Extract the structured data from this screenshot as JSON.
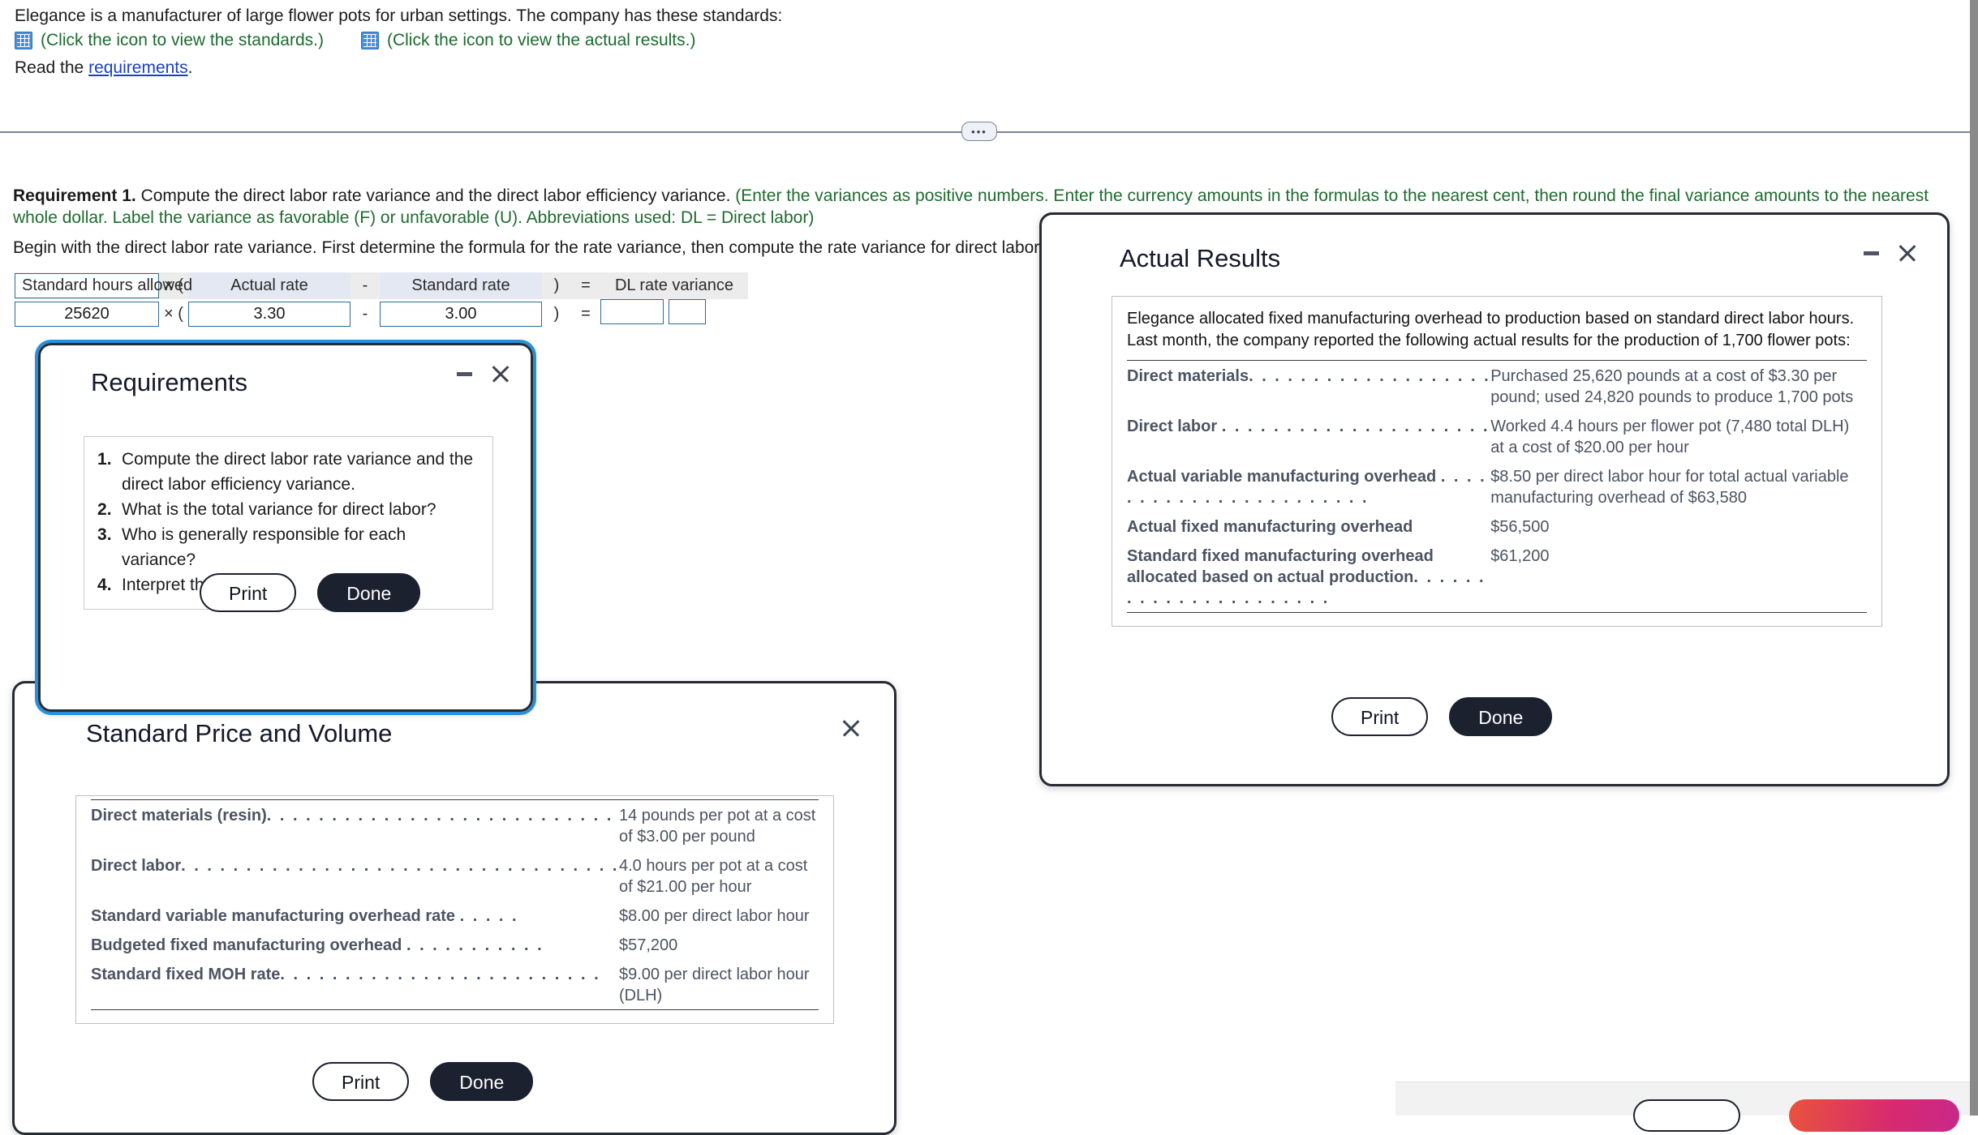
{
  "page": {
    "intro": "Elegance is a manufacturer of large flower pots for urban settings. The company has these standards:",
    "standards_link": "(Click the icon to view the standards.)",
    "actual_results_link": "(Click the icon to view the actual results.)",
    "read_prefix": "Read the",
    "read_link": "requirements",
    "read_suffix": ".",
    "divider_handle": "•••"
  },
  "requirement": {
    "label": "Requirement 1.",
    "statement": "Compute the direct labor rate variance and the direct labor efficiency variance.",
    "hint": "(Enter the variances as positive numbers. Enter the currency amounts in the formulas to the nearest cent, then round the final variance amounts to the nearest whole dollar. Label the variance as favorable (F) or unfavorable (U). Abbreviations used: DL = Direct labor)",
    "begin": "Begin with the direct labor rate variance. First determine the formula for the rate variance, then compute the rate variance for direct labor."
  },
  "formula": {
    "headers": {
      "standard_hours_allowed": "Standard hours allowed",
      "times_open_paren": "× (",
      "actual_rate": "Actual rate",
      "minus": "-",
      "standard_rate": "Standard rate",
      "close_paren": ")",
      "equals": "=",
      "dl_rate_variance": "DL rate variance"
    },
    "values": {
      "standard_hours_allowed": "25620",
      "times_open_paren": "× (",
      "actual_rate": "3.30",
      "minus": "-",
      "standard_rate": "3.00",
      "close_paren": ")",
      "equals": "=",
      "dl_rate_variance": "",
      "fav_unfav": ""
    }
  },
  "requirements_dialog": {
    "title": "Requirements",
    "items": [
      "Compute the direct labor rate variance and the direct labor efficiency variance.",
      "What is the total variance for direct labor?",
      "Who is generally responsible for each variance?",
      "Interpret the variances."
    ],
    "print_label": "Print",
    "done_label": "Done"
  },
  "actual_results_dialog": {
    "title": "Actual Results",
    "intro": "Elegance allocated fixed manufacturing overhead to production based on standard direct labor hours. Last month, the company reported the following actual results for the production of 1,700 flower pots:",
    "rows": [
      {
        "label": "Direct materials",
        "dots": ". . . . . . . . . . . . . . . . . . .",
        "value": "Purchased 25,620 pounds at a cost of $3.30 per pound; used 24,820 pounds to produce 1,700 pots"
      },
      {
        "label": "Direct labor",
        "dots": ". . . . . . . . . . . . . . . . . . . . .",
        "value": "Worked 4.4 hours per flower pot (7,480 total DLH) at a cost of $20.00 per hour"
      },
      {
        "label": "Actual variable manufacturing overhead",
        "dots": ". . . . . . . . . . . . . . . . . . . . . . .",
        "value": "$8.50 per direct labor hour for total actual variable manufacturing overhead of $63,580"
      },
      {
        "label": "Actual fixed manufacturing overhead",
        "dots": "",
        "value": "$56,500"
      },
      {
        "label": "Standard fixed manufacturing overhead allocated based on actual production",
        "dots": ". . . . . . . . . . . . . . . . . . . . . .",
        "value": "$61,200"
      }
    ],
    "print_label": "Print",
    "done_label": "Done"
  },
  "standard_dialog": {
    "title": "Standard Price and Volume",
    "rows": [
      {
        "label": "Direct materials (resin)",
        "dots": ". . . . . . . . . . . . . . . . . . . . . . . . . . .",
        "value": "14 pounds per pot at a cost of $3.00 per pound"
      },
      {
        "label": "Direct labor",
        "dots": ". . . . . . . . . . . . . . . . . . . . . . . . . . . . . . . . . .",
        "value": "4.0 hours per pot at a cost of $21.00 per hour"
      },
      {
        "label": "Standard variable manufacturing overhead rate",
        "dots": ". . . . .",
        "value": "$8.00 per direct labor hour"
      },
      {
        "label": "Budgeted fixed manufacturing overhead",
        "dots": ". . . . . . . . . . .",
        "value": "$57,200"
      },
      {
        "label": "Standard fixed MOH rate",
        "dots": ". . . . . . . . . . . . . . . . . . . . . . . . .",
        "value": "$9.00 per direct labor hour (DLH)"
      }
    ],
    "print_label": "Print",
    "done_label": "Done"
  },
  "colors": {
    "accent_blue": "#2a8fd8",
    "link_blue": "#1a3fc4",
    "hint_green": "#1d6b2e",
    "dark_button": "#1c2130",
    "gradient_start": "#e8543c",
    "gradient_end": "#c8288a"
  }
}
